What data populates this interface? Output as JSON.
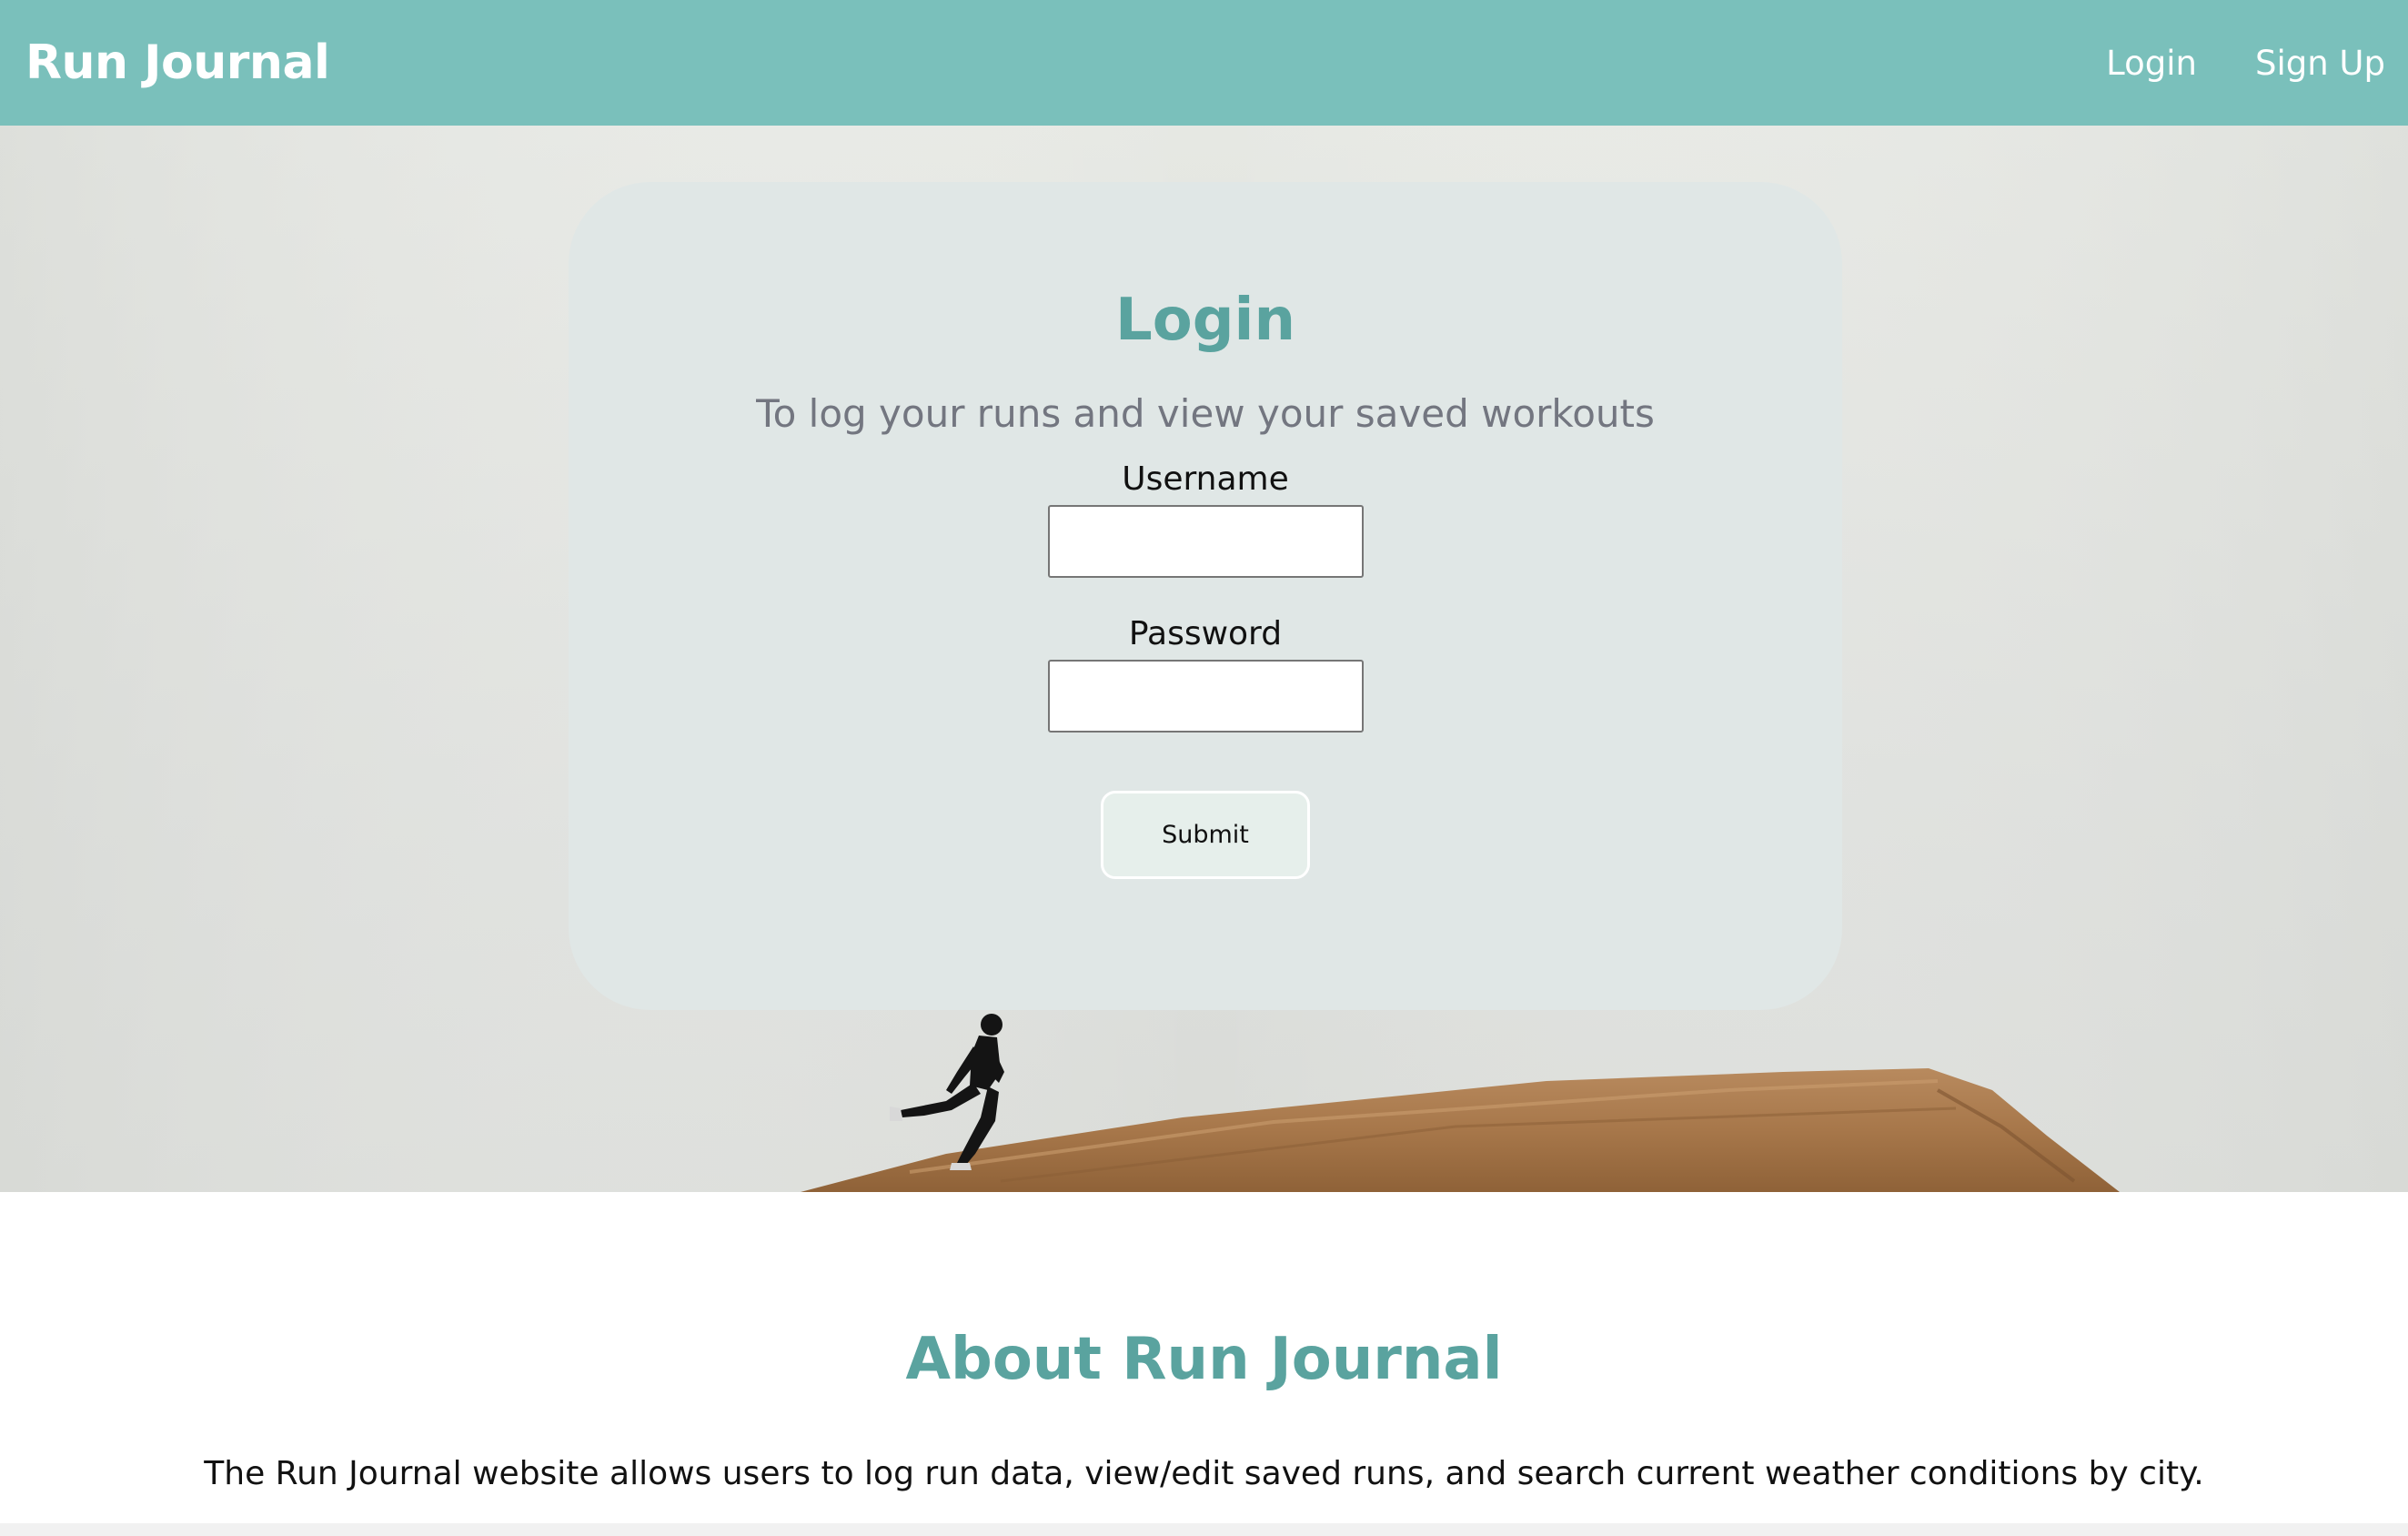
{
  "colors": {
    "accent": "#7ac0bb",
    "heading": "#5aa39f",
    "card_background": "#e0e7e6",
    "subtitle": "#737680"
  },
  "navbar": {
    "brand": "Run Journal",
    "links": [
      {
        "label": "Login"
      },
      {
        "label": "Sign Up"
      }
    ]
  },
  "hero": {
    "image": "runner-on-rock-icon"
  },
  "login_card": {
    "title": "Login",
    "subtitle": "To log your runs and view your saved workouts",
    "username": {
      "label": "Username",
      "value": "",
      "placeholder": ""
    },
    "password": {
      "label": "Password",
      "value": "",
      "placeholder": ""
    },
    "submit_label": "Submit"
  },
  "about": {
    "title": "About Run Journal",
    "text": "The Run Journal website allows users to log run data, view/edit saved runs, and search current weather conditions by city."
  }
}
